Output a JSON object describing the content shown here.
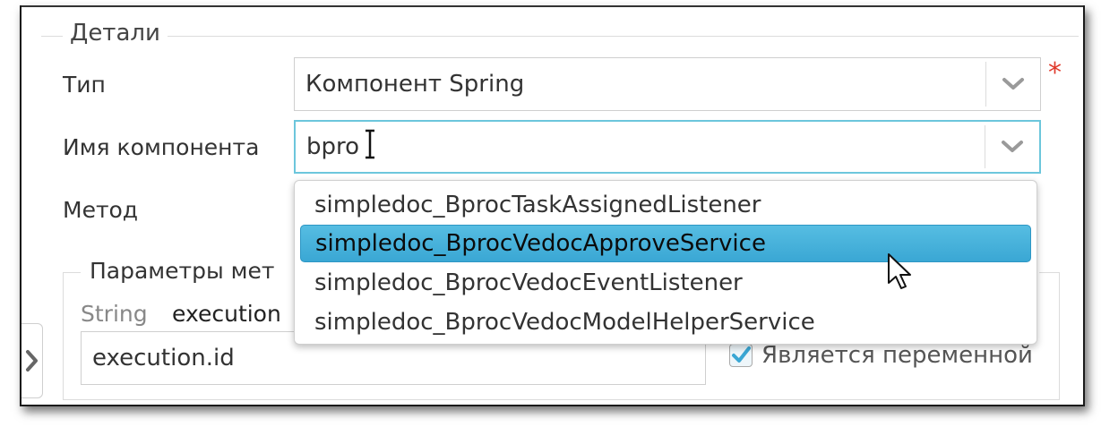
{
  "details": {
    "legend": "Детали"
  },
  "type_field": {
    "label": "Тип",
    "value": "Компонент Spring",
    "required_mark": "*"
  },
  "component_field": {
    "label": "Имя компонента",
    "value": "bpro"
  },
  "method_field": {
    "label": "Метод"
  },
  "dropdown": {
    "items": [
      {
        "label": "simpledoc_BprocTaskAssignedListener",
        "selected": false
      },
      {
        "label": "simpledoc_BprocVedocApproveService",
        "selected": true
      },
      {
        "label": "simpledoc_BprocVedocEventListener",
        "selected": false
      },
      {
        "label": "simpledoc_BprocVedocModelHelperService",
        "selected": false
      }
    ]
  },
  "params": {
    "legend": "Параметры мет",
    "type_label": "String",
    "name_label": "execution",
    "value": "execution.id",
    "checkbox_label": "Является переменной",
    "checkbox_checked": true
  },
  "icons": {
    "type_dropdown": "chevron-down-icon",
    "component_dropdown": "chevron-down-icon",
    "side_toggle": "chevron-right-icon",
    "text_cursor": "ibeam-cursor-icon",
    "mouse": "arrow-pointer-icon",
    "checkbox": "checkmark-icon"
  },
  "colors": {
    "accent": "#3aa7d4",
    "focus_border": "#6cc6dc",
    "required": "#e0392b"
  }
}
